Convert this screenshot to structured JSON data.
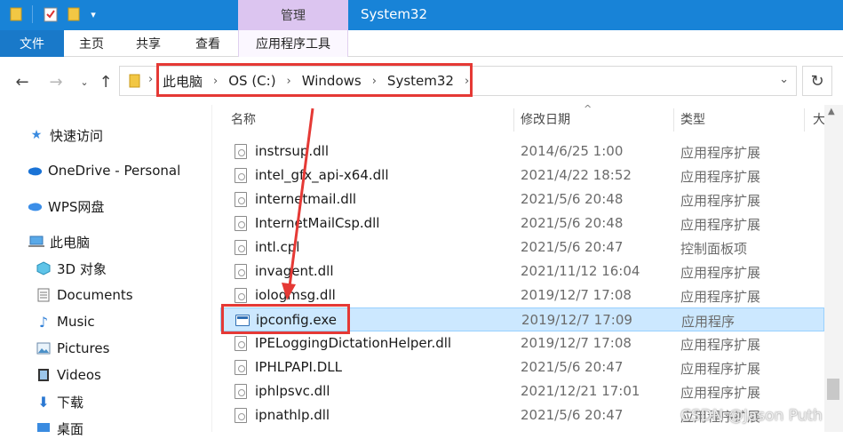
{
  "window": {
    "title": "System32",
    "context_tab": "管理"
  },
  "ribbon": {
    "tabs": [
      "文件",
      "主页",
      "共享",
      "查看",
      "应用程序工具"
    ]
  },
  "address": {
    "crumbs": [
      "此电脑",
      "OS (C:)",
      "Windows",
      "System32"
    ]
  },
  "sidebar": {
    "items": [
      {
        "label": "快速访问",
        "icon": "star-icon"
      },
      {
        "label": "OneDrive - Personal",
        "icon": "cloud-icon"
      },
      {
        "label": "WPS网盘",
        "icon": "cloud-icon"
      },
      {
        "label": "此电脑",
        "icon": "computer-icon"
      },
      {
        "label": "3D 对象",
        "icon": "cube-icon"
      },
      {
        "label": "Documents",
        "icon": "document-icon"
      },
      {
        "label": "Music",
        "icon": "music-icon"
      },
      {
        "label": "Pictures",
        "icon": "picture-icon"
      },
      {
        "label": "Videos",
        "icon": "video-icon"
      },
      {
        "label": "下载",
        "icon": "download-icon"
      },
      {
        "label": "桌面",
        "icon": "desktop-icon"
      }
    ]
  },
  "columns": {
    "name": "名称",
    "date": "修改日期",
    "type": "类型",
    "size": "大"
  },
  "files": [
    {
      "name": "instrsup.dll",
      "date": "2014/6/25 1:00",
      "type": "应用程序扩展",
      "kind": "dll"
    },
    {
      "name": "intel_gfx_api-x64.dll",
      "date": "2021/4/22 18:52",
      "type": "应用程序扩展",
      "kind": "dll"
    },
    {
      "name": "internetmail.dll",
      "date": "2021/5/6 20:48",
      "type": "应用程序扩展",
      "kind": "dll"
    },
    {
      "name": "InternetMailCsp.dll",
      "date": "2021/5/6 20:48",
      "type": "应用程序扩展",
      "kind": "dll"
    },
    {
      "name": "intl.cpl",
      "date": "2021/5/6 20:47",
      "type": "控制面板项",
      "kind": "dll"
    },
    {
      "name": "invagent.dll",
      "date": "2021/11/12 16:04",
      "type": "应用程序扩展",
      "kind": "dll"
    },
    {
      "name": "iologmsg.dll",
      "date": "2019/12/7 17:08",
      "type": "应用程序扩展",
      "kind": "dll"
    },
    {
      "name": "ipconfig.exe",
      "date": "2019/12/7 17:09",
      "type": "应用程序",
      "kind": "exe",
      "selected": true
    },
    {
      "name": "IPELoggingDictationHelper.dll",
      "date": "2019/12/7 17:08",
      "type": "应用程序扩展",
      "kind": "dll"
    },
    {
      "name": "IPHLPAPI.DLL",
      "date": "2021/5/6 20:47",
      "type": "应用程序扩展",
      "kind": "dll"
    },
    {
      "name": "iphlpsvc.dll",
      "date": "2021/12/21 17:01",
      "type": "应用程序扩展",
      "kind": "dll"
    },
    {
      "name": "ipnathlp.dll",
      "date": "2021/5/6 20:47",
      "type": "应用程序扩展",
      "kind": "dll"
    }
  ],
  "watermark": "CSDN @Jason Puth"
}
